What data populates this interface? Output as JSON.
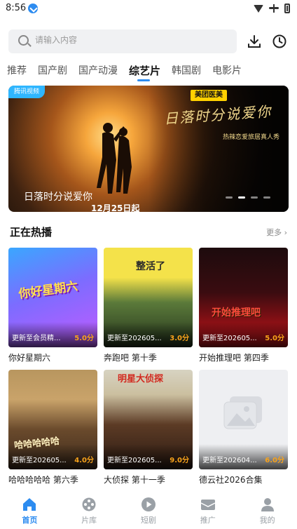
{
  "status": {
    "time": "8:56"
  },
  "search": {
    "placeholder": "请输入内容",
    "download_icon": "download-icon",
    "history_icon": "clock-icon"
  },
  "tabs": [
    {
      "label": "推荐"
    },
    {
      "label": "国产剧"
    },
    {
      "label": "国产动漫"
    },
    {
      "label": "综艺片",
      "active": true
    },
    {
      "label": "韩国剧"
    },
    {
      "label": "电影片"
    }
  ],
  "banner": {
    "logo": "腾讯视频",
    "brand": "美团医美",
    "calligraphy": "日落时分说爱你",
    "tagline": "热辣恋爱旅居真人秀",
    "title": "日落时分说爱你",
    "date": "12月25日起",
    "dots": 4,
    "active_dot": 1
  },
  "section": {
    "title": "正在热播",
    "more": "更多 ›"
  },
  "cards": [
    {
      "title": "你好星期六",
      "update": "更新至会员精...",
      "score": "5.0分",
      "poster_text": "你好星期六",
      "colors": [
        "#3aa7ff",
        "#c25bff"
      ]
    },
    {
      "title": "奔跑吧 第十季",
      "update": "更新至202605...",
      "score": "3.0分",
      "poster_text": "整活了",
      "colors": [
        "#f4e24a",
        "#3a5c2e"
      ]
    },
    {
      "title": "开始推理吧 第四季",
      "update": "更新至202605...",
      "score": "5.0分",
      "poster_text": "开始推理吧",
      "colors": [
        "#3a0c10",
        "#b5151c"
      ]
    },
    {
      "title": "哈哈哈哈哈 第六季",
      "update": "更新至202605...",
      "score": "4.0分",
      "poster_text": "哈哈哈哈哈",
      "colors": [
        "#c9a36a",
        "#3e2b1c"
      ]
    },
    {
      "title": "大侦探 第十一季",
      "update": "更新至202605...",
      "score": "9.0分",
      "poster_text": "明星大侦探",
      "colors": [
        "#d7d3c2",
        "#2b1a12"
      ]
    },
    {
      "title": "德云社2026合集",
      "update": "更新至202604...",
      "score": "6.0分",
      "poster_text": "",
      "colors": [
        "#e9eaee",
        "#f5f5f7"
      ]
    }
  ],
  "nav": [
    {
      "label": "首页",
      "icon": "home-icon",
      "active": true
    },
    {
      "label": "片库",
      "icon": "film-reel-icon"
    },
    {
      "label": "短剧",
      "icon": "play-icon"
    },
    {
      "label": "推广",
      "icon": "mail-icon"
    },
    {
      "label": "我的",
      "icon": "profile-icon"
    }
  ],
  "colors": {
    "accent": "#2d8cf0",
    "score": "#f7a21b"
  }
}
